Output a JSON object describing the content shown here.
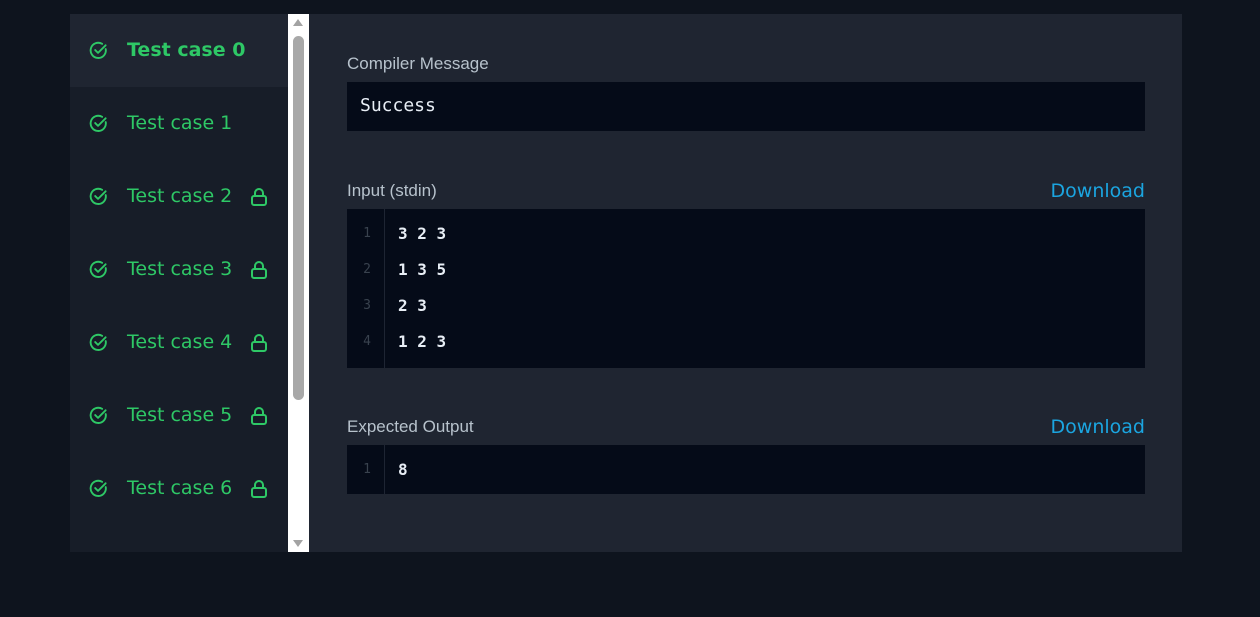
{
  "sidebar": {
    "items": [
      {
        "label": "Test case 0",
        "active": true,
        "locked": false,
        "status": "passed"
      },
      {
        "label": "Test case 1",
        "active": false,
        "locked": false,
        "status": "passed"
      },
      {
        "label": "Test case 2",
        "active": false,
        "locked": true,
        "status": "passed"
      },
      {
        "label": "Test case 3",
        "active": false,
        "locked": true,
        "status": "passed"
      },
      {
        "label": "Test case 4",
        "active": false,
        "locked": true,
        "status": "passed"
      },
      {
        "label": "Test case 5",
        "active": false,
        "locked": true,
        "status": "passed"
      },
      {
        "label": "Test case 6",
        "active": false,
        "locked": true,
        "status": "passed"
      }
    ]
  },
  "compiler": {
    "title": "Compiler Message",
    "message": "Success"
  },
  "input": {
    "title": "Input (stdin)",
    "download_label": "Download",
    "lines": [
      {
        "num": "1",
        "text": "3 2 3"
      },
      {
        "num": "2",
        "text": "1 3 5"
      },
      {
        "num": "3",
        "text": "2 3"
      },
      {
        "num": "4",
        "text": "1 2 3"
      }
    ]
  },
  "expected": {
    "title": "Expected Output",
    "download_label": "Download",
    "lines": [
      {
        "num": "1",
        "text": "8"
      }
    ]
  },
  "colors": {
    "success_green": "#2ec866",
    "link_blue": "#1ba5e0",
    "page_bg": "#0e141e",
    "panel_bg": "#1f2531",
    "code_bg": "#050b18"
  },
  "icons": {
    "status": "check-circle-icon",
    "locked": "lock-icon"
  }
}
